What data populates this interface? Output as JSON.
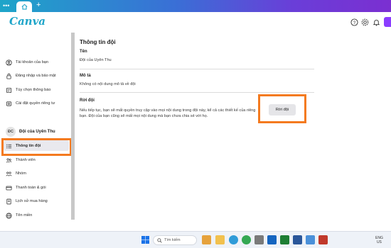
{
  "browser": {
    "dots": "•••",
    "new_tab": "+"
  },
  "header": {
    "logo": "Canva",
    "icons": [
      "help-icon",
      "gear-icon",
      "bell-icon"
    ],
    "accent_color": "#8b3dff"
  },
  "sidebar": {
    "items": [
      {
        "label": "Tài khoản của bạn",
        "icon": "account-icon"
      },
      {
        "label": "Đăng nhập và bảo mật",
        "icon": "lock-icon"
      },
      {
        "label": "Tùy chọn thông báo",
        "icon": "notification-icon"
      },
      {
        "label": "Cài đặt quyền riêng tư",
        "icon": "privacy-icon"
      }
    ],
    "team": {
      "avatar": "ĐC",
      "name": "Đội của Uyên Thu"
    },
    "team_items": [
      {
        "label": "Thông tin đội",
        "icon": "list-icon",
        "active": true
      },
      {
        "label": "Thành viên",
        "icon": "members-icon"
      },
      {
        "label": "Nhóm",
        "icon": "groups-icon"
      },
      {
        "label": "Thanh toán & gói",
        "icon": "billing-icon"
      },
      {
        "label": "Lịch sử mua hàng",
        "icon": "history-icon"
      },
      {
        "label": "Tên miền",
        "icon": "globe-icon"
      }
    ]
  },
  "main": {
    "title": "Thông tin đội",
    "name_label": "Tên",
    "name_value": "Đội của Uyên Thu",
    "desc_label": "Mô tả",
    "desc_value": "Không có nội dung mô tả về đội",
    "leave_label": "Rời đội",
    "leave_desc": "Nếu tiếp tục, bạn sẽ mất quyền truy cập vào mọi nội dung trong đội này, kể cả các thiết kế của riêng bạn. Đội của bạn cũng sẽ mất mọi nội dung mà bạn chưa chia sẻ với họ.",
    "leave_button": "Rời đội"
  },
  "taskbar": {
    "search_placeholder": "Tìm kiếm",
    "lang_top": "ENG",
    "lang_bottom": "US"
  },
  "highlight_color": "#f47a1f"
}
